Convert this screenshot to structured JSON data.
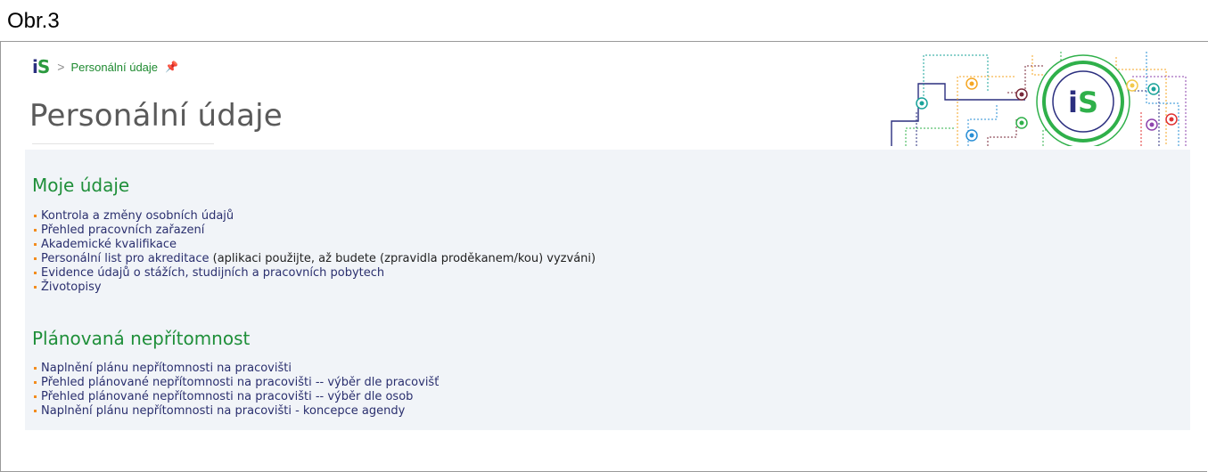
{
  "caption": "Obr.3",
  "breadcrumb": {
    "logo": "iS",
    "separator": ">",
    "current": "Personální údaje",
    "pin_icon": "pin-icon"
  },
  "page_title": "Personální údaje",
  "sections": [
    {
      "heading": "Moje údaje",
      "items": [
        {
          "label": "Kontrola a změny osobních údajů",
          "note": ""
        },
        {
          "label": "Přehled pracovních zařazení",
          "note": ""
        },
        {
          "label": "Akademické kvalifikace",
          "note": ""
        },
        {
          "label": "Personální list pro akreditace",
          "note": " (aplikaci použijte, až budete (zpravidla proděkanem/kou) vyzváni)"
        },
        {
          "label": "Evidence údajů o stážích, studijních a pracovních pobytech",
          "note": ""
        },
        {
          "label": "Životopisy",
          "note": ""
        }
      ]
    },
    {
      "heading": "Plánovaná nepřítomnost",
      "items": [
        {
          "label": "Naplnění plánu nepřítomnosti na pracovišti",
          "note": ""
        },
        {
          "label": "Přehled plánované nepřítomnosti na pracovišti -- výběr dle pracovišť",
          "note": ""
        },
        {
          "label": "Přehled plánované nepřítomnosti na pracovišti -- výběr dle osob",
          "note": ""
        },
        {
          "label": "Naplnění plánu nepřítomnosti na pracovišti - koncepce agendy",
          "note": ""
        }
      ]
    }
  ],
  "decoration": {
    "logo_text": "iS",
    "colors": {
      "green": "#2fb04a",
      "navy": "#2b2f7f",
      "orange": "#f5a623",
      "teal": "#1aa39a",
      "maroon": "#7a2a3a",
      "purple": "#8e44ad",
      "red": "#e03131",
      "blue": "#2a8fd6",
      "yellow": "#f2c94c"
    }
  }
}
